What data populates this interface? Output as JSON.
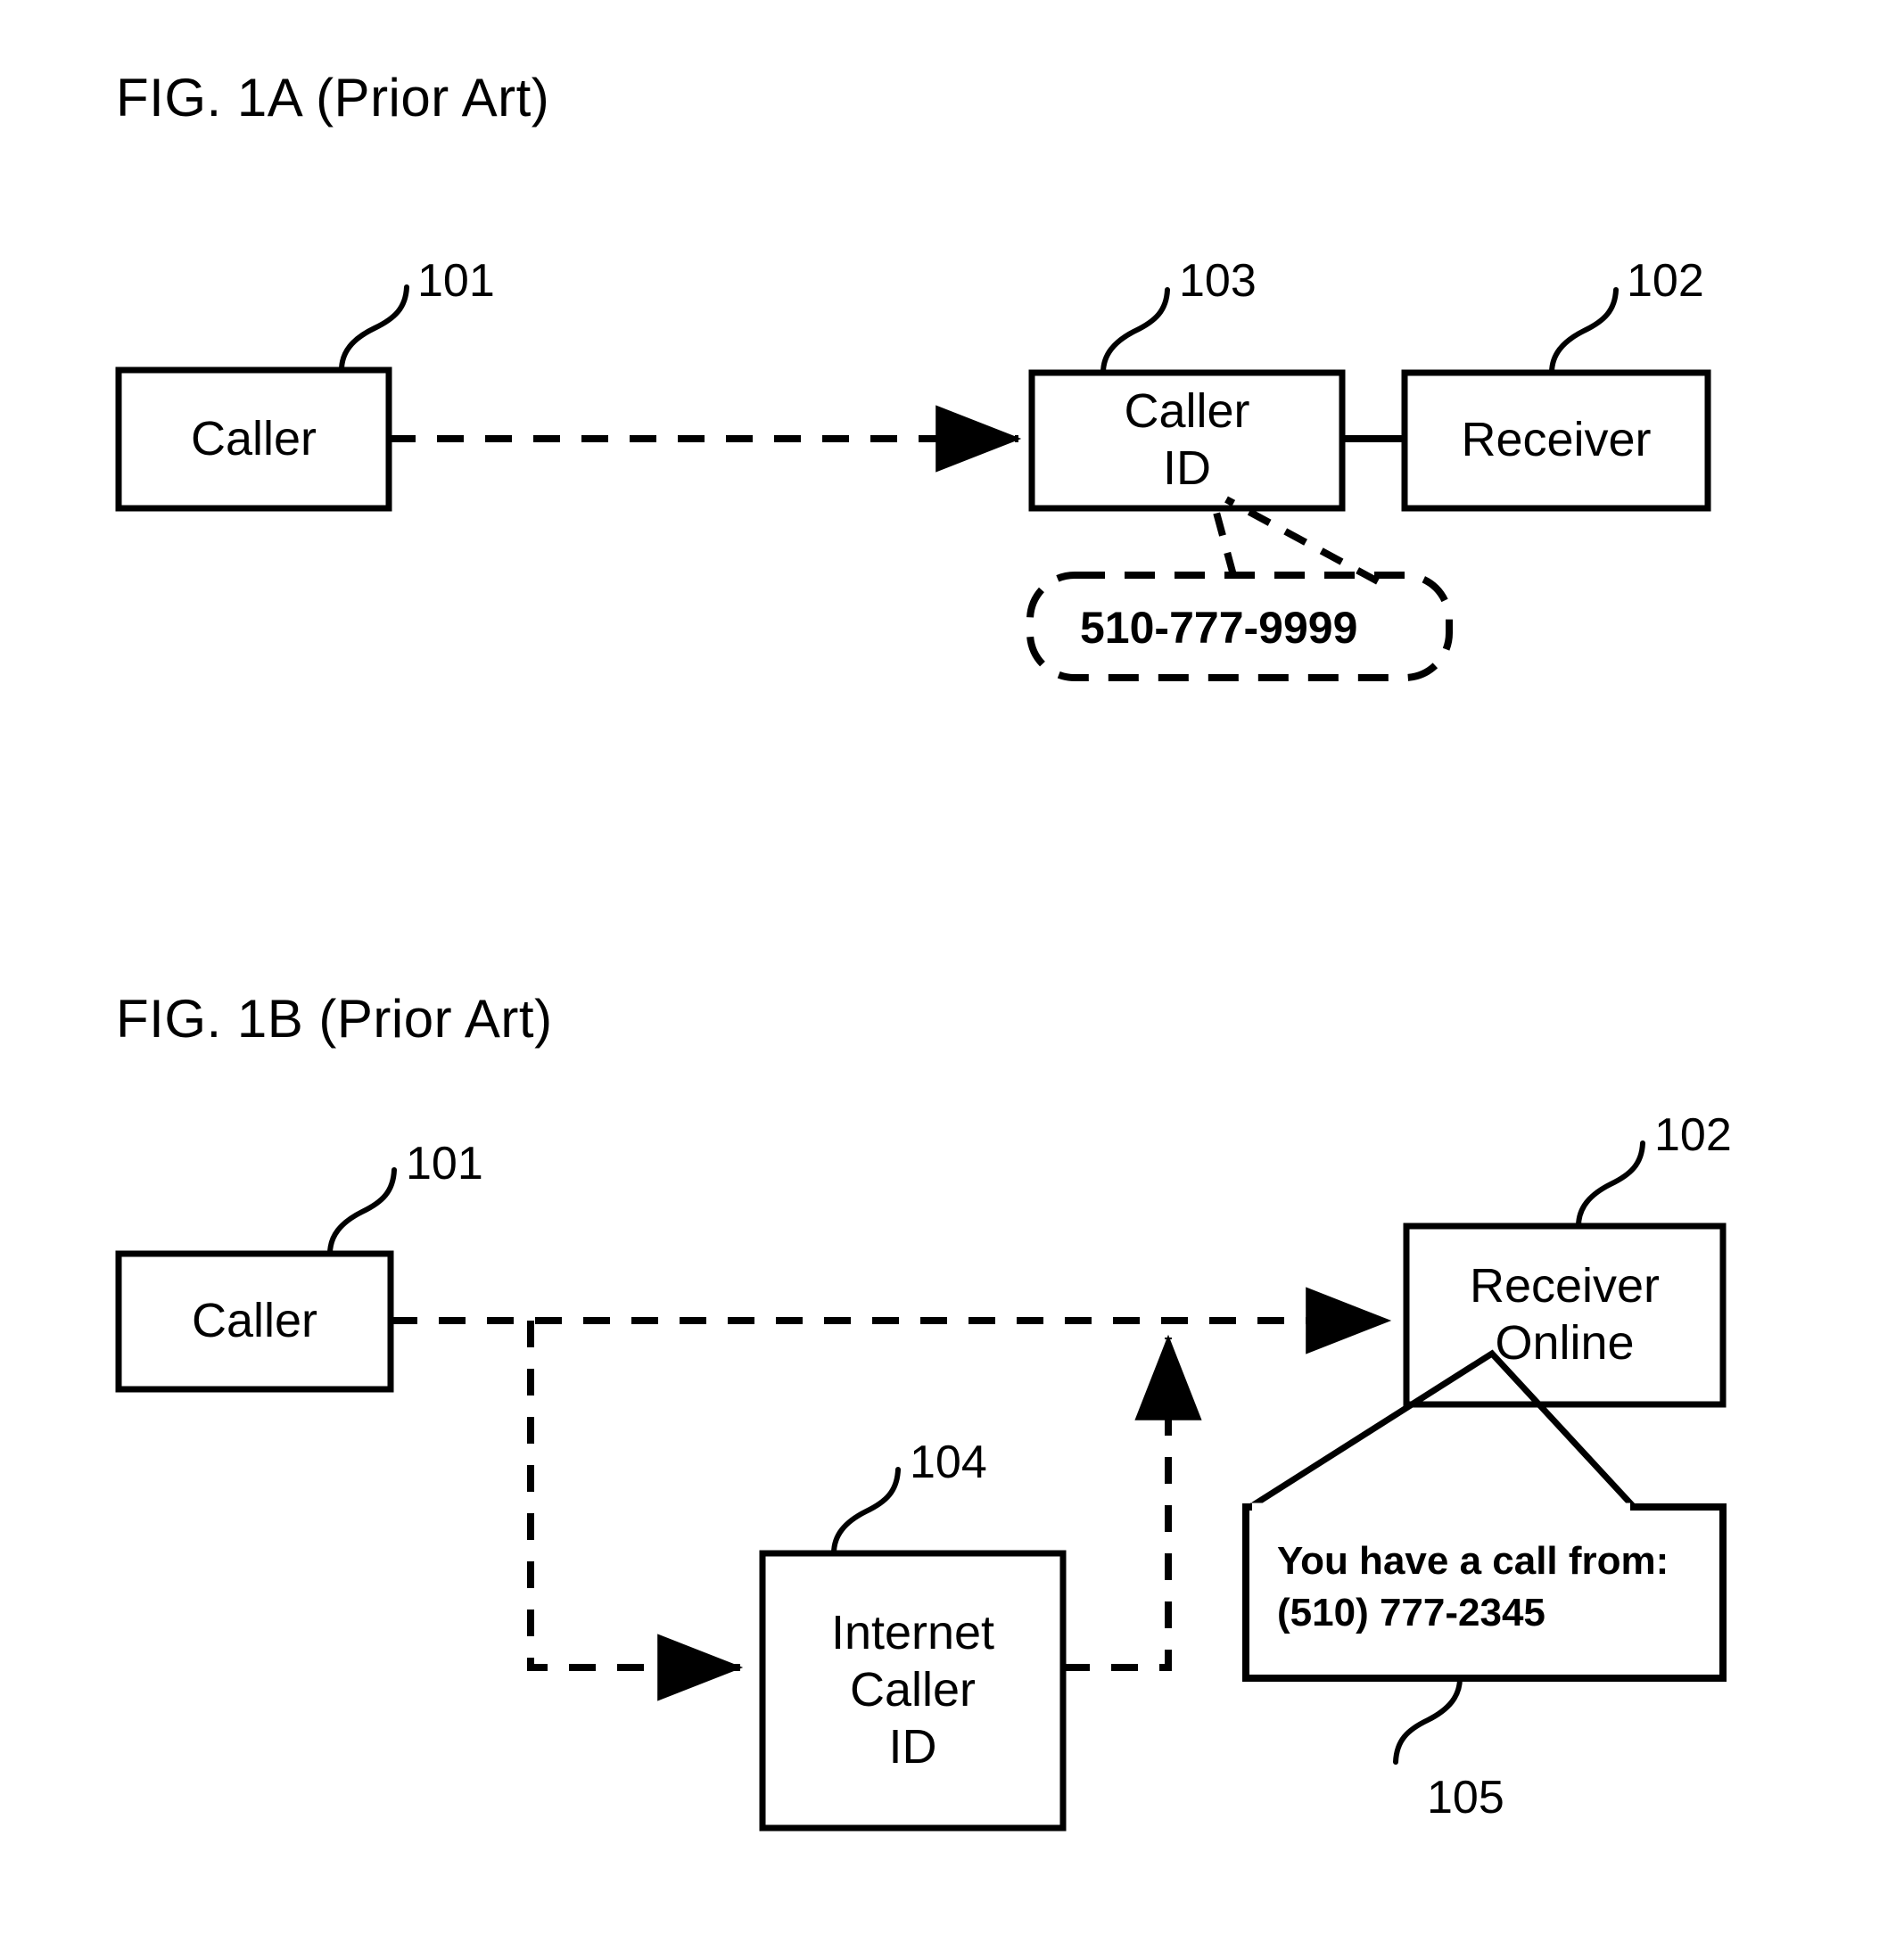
{
  "figures": [
    {
      "title": "FIG. 1A (Prior Art)",
      "nodes": [
        {
          "id": "caller",
          "label_lines": [
            "Caller"
          ],
          "ref": "101"
        },
        {
          "id": "caller-id",
          "label_lines": [
            "Caller",
            "ID"
          ],
          "ref": "103"
        },
        {
          "id": "receiver",
          "label_lines": [
            "Receiver"
          ],
          "ref": "102"
        }
      ],
      "callout": {
        "text": "510-777-9999",
        "style": "dashed-rounded"
      }
    },
    {
      "title": "FIG. 1B (Prior Art)",
      "nodes": [
        {
          "id": "caller",
          "label_lines": [
            "Caller"
          ],
          "ref": "101"
        },
        {
          "id": "internet-caller-id",
          "label_lines": [
            "Internet",
            "Caller",
            "ID"
          ],
          "ref": "104"
        },
        {
          "id": "receiver-online",
          "label_lines": [
            "Receiver",
            "Online"
          ],
          "ref": "102"
        }
      ],
      "notification": {
        "line1": "You have a call from:",
        "line2": "(510) 777-2345",
        "ref": "105",
        "style": "solid-speech-bubble"
      }
    }
  ],
  "fig1a": {
    "title": "FIG. 1A (Prior Art)",
    "caller_label": "Caller",
    "caller_ref": "101",
    "callerid_line1": "Caller",
    "callerid_line2": "ID",
    "callerid_ref": "103",
    "receiver_label": "Receiver",
    "receiver_ref": "102",
    "callout_text": "510-777-9999"
  },
  "fig1b": {
    "title": "FIG. 1B (Prior Art)",
    "caller_label": "Caller",
    "caller_ref": "101",
    "icid_line1": "Internet",
    "icid_line2": "Caller",
    "icid_line3": "ID",
    "icid_ref": "104",
    "receiver_line1": "Receiver",
    "receiver_line2": "Online",
    "receiver_ref": "102",
    "notif_line1": "You have a call from:",
    "notif_line2": "(510) 777-2345",
    "notif_ref": "105"
  },
  "colors": {
    "ink": "#000000",
    "paper": "#ffffff"
  }
}
